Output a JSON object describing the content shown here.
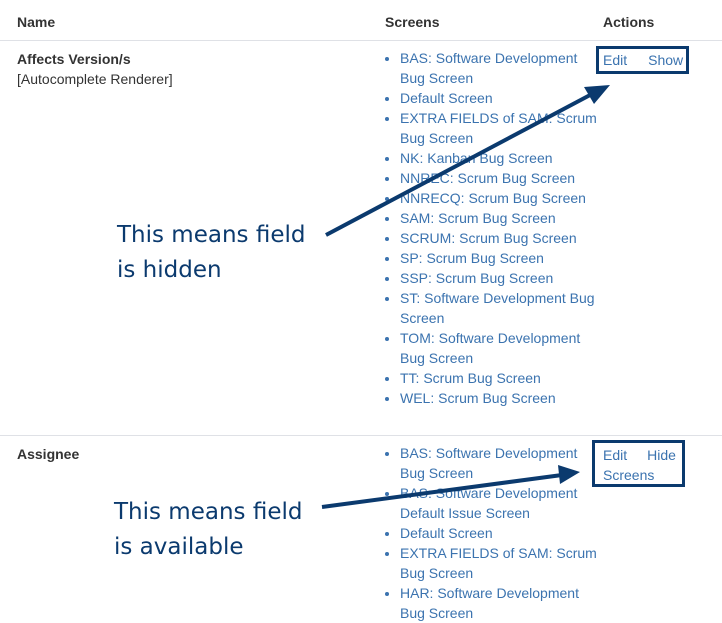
{
  "header": {
    "name": "Name",
    "screens": "Screens",
    "actions": "Actions"
  },
  "rows": [
    {
      "field_name": "Affects Version/s",
      "renderer": "[Autocomplete Renderer]",
      "screens": [
        "BAS: Software Development Bug Screen",
        "Default Screen",
        "EXTRA FIELDS of SAM: Scrum Bug Screen",
        "NK: Kanban Bug Screen",
        "NNREC: Scrum Bug Screen",
        "NNRECQ: Scrum Bug Screen",
        "SAM: Scrum Bug Screen",
        "SCRUM: Scrum Bug Screen",
        "SP: Scrum Bug Screen",
        "SSP: Scrum Bug Screen",
        "ST: Software Development Bug Screen",
        "TOM: Software Development Bug Screen",
        "TT: Scrum Bug Screen",
        "WEL: Scrum Bug Screen"
      ],
      "actions": [
        "Edit",
        "Show"
      ]
    },
    {
      "field_name": "Assignee",
      "screens": [
        "BAS: Software Development Bug Screen",
        "BAS: Software Development Default Issue Screen",
        "Default Screen",
        "EXTRA FIELDS of SAM: Scrum Bug Screen",
        "HAR: Software Development Bug Screen"
      ],
      "actions": [
        "Edit",
        "Hide",
        "Screens"
      ]
    }
  ],
  "annotations": {
    "hidden": [
      "This means field",
      "is hidden"
    ],
    "available": [
      "This means field",
      "is available"
    ],
    "color": "#0b3a6e"
  },
  "colors": {
    "link": "#3b73af",
    "text": "#333333",
    "border": "#dfe1e6"
  }
}
